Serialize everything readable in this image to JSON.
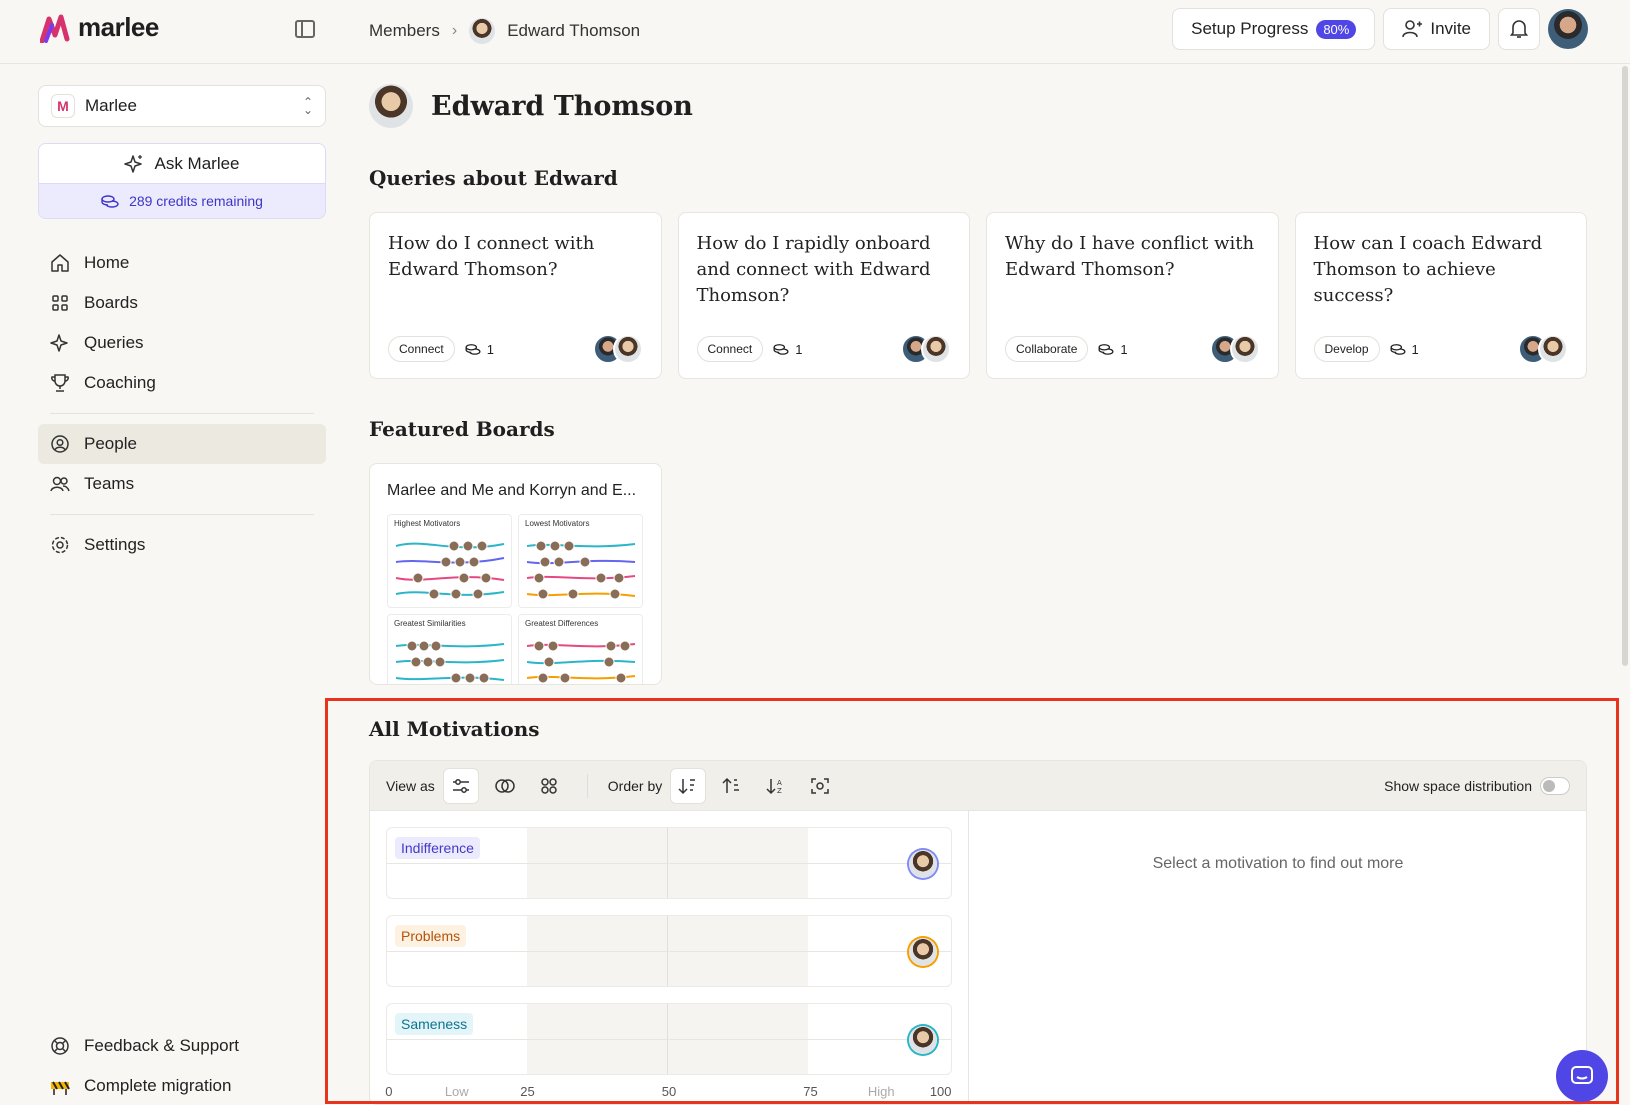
{
  "app": {
    "name": "marlee"
  },
  "breadcrumb": {
    "parent": "Members",
    "current": "Edward Thomson"
  },
  "top": {
    "setup_label": "Setup Progress",
    "setup_pct": "80%",
    "invite_label": "Invite"
  },
  "sidebar": {
    "workspace": "Marlee",
    "ask_label": "Ask Marlee",
    "credits": "289 credits remaining",
    "items": [
      {
        "label": "Home",
        "icon": "home-icon"
      },
      {
        "label": "Boards",
        "icon": "grid-icon"
      },
      {
        "label": "Queries",
        "icon": "sparkle-icon"
      },
      {
        "label": "Coaching",
        "icon": "trophy-icon"
      },
      {
        "label": "People",
        "icon": "person-circle-icon"
      },
      {
        "label": "Teams",
        "icon": "users-icon"
      },
      {
        "label": "Settings",
        "icon": "gear-icon"
      }
    ],
    "bottom": [
      {
        "label": "Feedback & Support",
        "icon": "lifebuoy-icon"
      },
      {
        "label": "Complete migration",
        "icon": "construction-icon"
      }
    ]
  },
  "person": {
    "name": "Edward Thomson"
  },
  "queries": {
    "title": "Queries about Edward",
    "cards": [
      {
        "title": "How do I connect with Edward Thomson?",
        "tag": "Connect",
        "count": "1"
      },
      {
        "title": "How do I rapidly onboard and connect with Edward Thomson?",
        "tag": "Connect",
        "count": "1"
      },
      {
        "title": "Why do I have conflict with Edward Thomson?",
        "tag": "Collaborate",
        "count": "1"
      },
      {
        "title": "How can I coach Edward Thomson to achieve success?",
        "tag": "Develop",
        "count": "1"
      }
    ]
  },
  "featured": {
    "title": "Featured Boards",
    "board": {
      "title": "Marlee and Me and Korryn and E...",
      "panels": [
        "Highest Motivators",
        "Lowest Motivators",
        "Greatest Similarities",
        "Greatest Differences"
      ]
    }
  },
  "motivations": {
    "title": "All Motivations",
    "view_as": "View as",
    "order_by": "Order by",
    "show_space": "Show space distribution",
    "placeholder": "Select a motivation to find out more",
    "rows": [
      {
        "label": "Indifference",
        "value": 100,
        "bg": "#ecebfd",
        "fg": "#4338ca"
      },
      {
        "label": "Problems",
        "value": 100,
        "bg": "#fdf1e2",
        "fg": "#b45309"
      },
      {
        "label": "Sameness",
        "value": 100,
        "bg": "#e3f5f8",
        "fg": "#0e7490"
      }
    ],
    "axis": [
      {
        "label": "0",
        "pos": 0
      },
      {
        "label": "Low",
        "pos": 12.5,
        "muted": true
      },
      {
        "label": "25",
        "pos": 25
      },
      {
        "label": "50",
        "pos": 50
      },
      {
        "label": "75",
        "pos": 75
      },
      {
        "label": "High",
        "pos": 87.5,
        "muted": true
      },
      {
        "label": "100",
        "pos": 100
      }
    ]
  },
  "colors": {
    "accent": "#4f46e5",
    "highlight": "#e8341c"
  }
}
